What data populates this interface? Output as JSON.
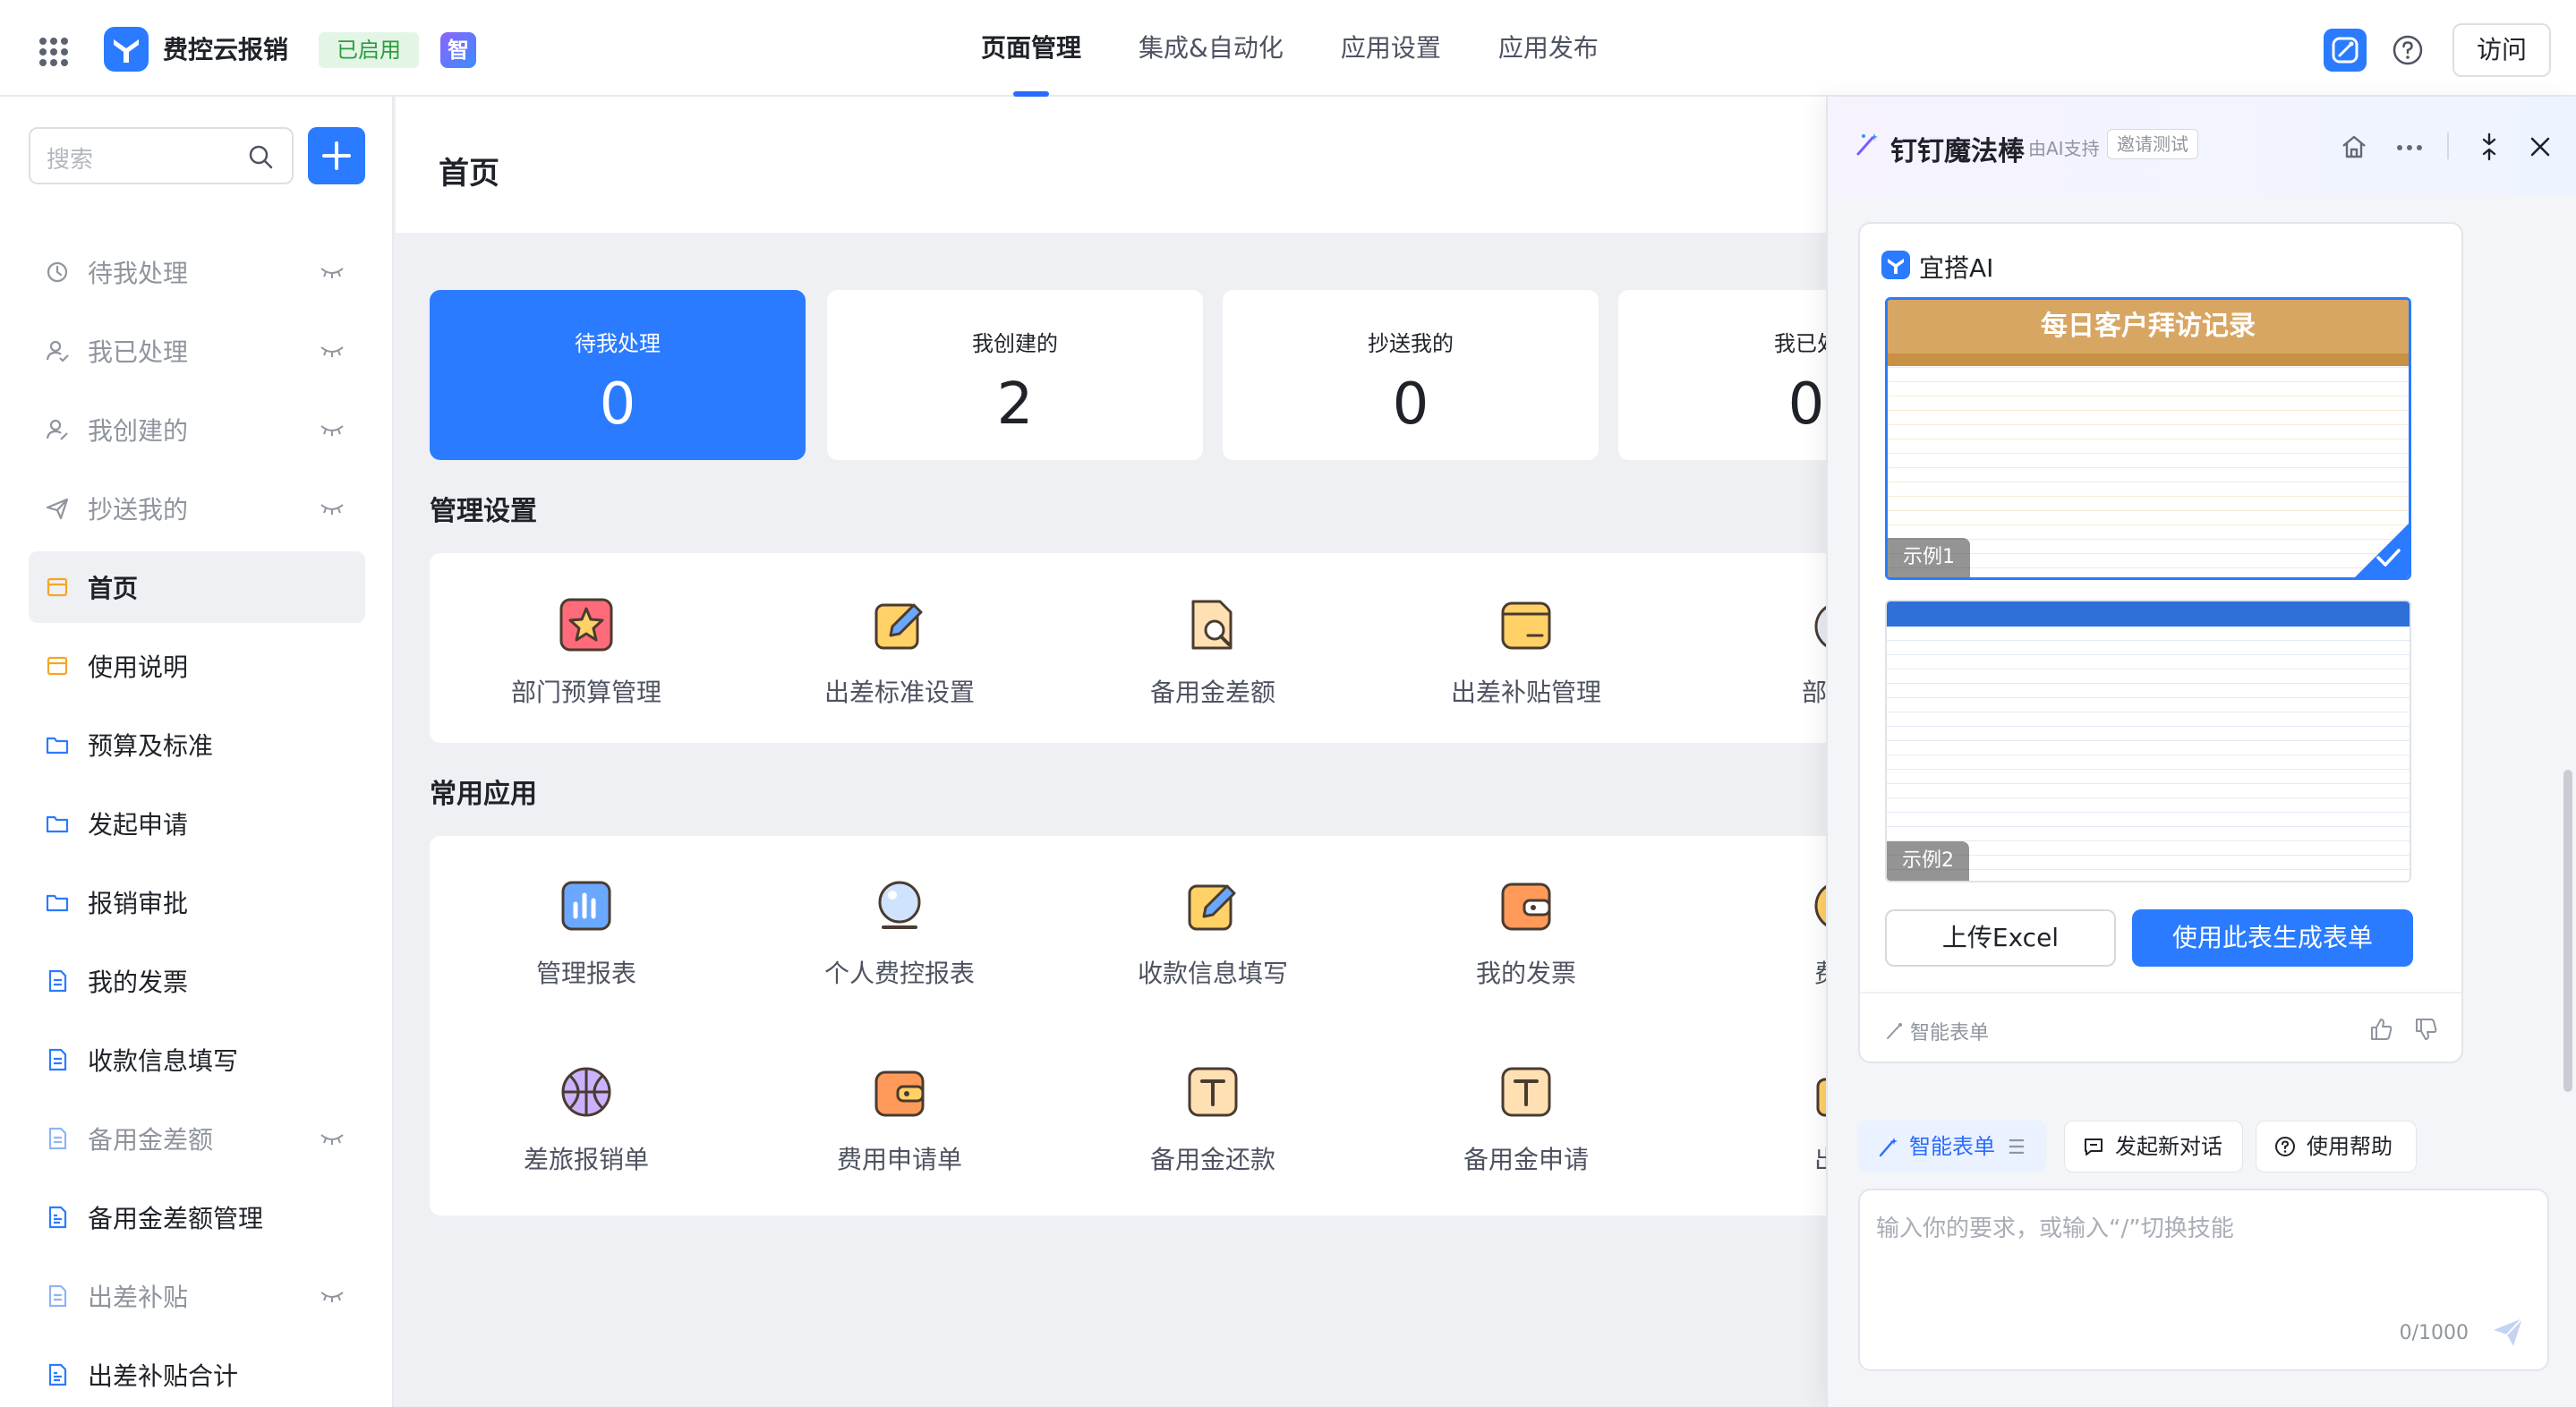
{
  "topbar": {
    "app_name": "费控云报销",
    "status": "已启用",
    "zhi": "智",
    "nav": [
      {
        "label": "页面管理",
        "active": true
      },
      {
        "label": "集成&自动化",
        "active": false
      },
      {
        "label": "应用设置",
        "active": false
      },
      {
        "label": "应用发布",
        "active": false
      }
    ],
    "visit_label": "访问",
    "accent_color": "#2a7bff"
  },
  "sidebar": {
    "search_placeholder": "搜索",
    "items": [
      {
        "label": "待我处理",
        "icon": "clock-icon",
        "muted": true,
        "hidden_eye": true
      },
      {
        "label": "我已处理",
        "icon": "user-check-icon",
        "muted": true,
        "hidden_eye": true
      },
      {
        "label": "我创建的",
        "icon": "user-edit-icon",
        "muted": true,
        "hidden_eye": true
      },
      {
        "label": "抄送我的",
        "icon": "send-icon",
        "muted": true,
        "hidden_eye": true
      },
      {
        "label": "首页",
        "icon": "page-icon",
        "active": true
      },
      {
        "label": "使用说明",
        "icon": "page-icon"
      },
      {
        "label": "预算及标准",
        "icon": "folder-icon"
      },
      {
        "label": "发起申请",
        "icon": "folder-icon"
      },
      {
        "label": "报销审批",
        "icon": "folder-icon"
      },
      {
        "label": "我的发票",
        "icon": "form-icon"
      },
      {
        "label": "收款信息填写",
        "icon": "form-icon"
      },
      {
        "label": "备用金差额",
        "icon": "form-icon",
        "muted": true,
        "hidden_eye": true
      },
      {
        "label": "备用金差额管理",
        "icon": "report-icon"
      },
      {
        "label": "出差补贴",
        "icon": "form-icon",
        "muted": true,
        "hidden_eye": true
      },
      {
        "label": "出差补贴合计",
        "icon": "report-icon"
      }
    ]
  },
  "main": {
    "page_title": "首页",
    "stats": [
      {
        "label": "待我处理",
        "value": "0",
        "primary": true
      },
      {
        "label": "我创建的",
        "value": "2"
      },
      {
        "label": "抄送我的",
        "value": "0"
      },
      {
        "label": "我已处",
        "value": "0"
      }
    ],
    "mgmt_title": "管理设置",
    "mgmt_items": [
      {
        "label": "部门预算管理",
        "icon": "star-badge-icon"
      },
      {
        "label": "出差标准设置",
        "icon": "edit-note-icon"
      },
      {
        "label": "备用金差额",
        "icon": "doc-search-icon"
      },
      {
        "label": "出差补贴管理",
        "icon": "wallet-icon"
      },
      {
        "label": "部门预",
        "icon": "gauge-icon"
      }
    ],
    "apps_title": "常用应用",
    "apps_row1": [
      {
        "label": "管理报表",
        "icon": "bar-chart-icon"
      },
      {
        "label": "个人费控报表",
        "icon": "crystal-ball-icon"
      },
      {
        "label": "收款信息填写",
        "icon": "edit-note-icon"
      },
      {
        "label": "我的发票",
        "icon": "card-wallet-icon"
      },
      {
        "label": "费用",
        "icon": "coin-icon"
      }
    ],
    "apps_row2": [
      {
        "label": "差旅报销单",
        "icon": "basketball-icon"
      },
      {
        "label": "费用申请单",
        "icon": "purse-icon"
      },
      {
        "label": "备用金还款",
        "icon": "t-box-icon"
      },
      {
        "label": "备用金申请",
        "icon": "t-box-icon"
      },
      {
        "label": "出差",
        "icon": "bag-icon"
      }
    ]
  },
  "ai_panel": {
    "title": "钉钉魔法棒",
    "subtitle": "由AI支持",
    "invite": "邀请测试",
    "card_title": "宜搭AI",
    "example1_title": "每日客户拜访记录",
    "example1_label": "示例1",
    "example2_label": "示例2",
    "upload_label": "上传Excel",
    "generate_label": "使用此表生成表单",
    "card_footer": "智能表单",
    "chips": [
      {
        "label": "智能表单",
        "icon": "wand-icon"
      },
      {
        "label": "发起新对话",
        "icon": "chat-icon"
      },
      {
        "label": "使用帮助",
        "icon": "help-icon"
      }
    ],
    "chip_menu": "☰",
    "input_placeholder": "输入你的要求，或输入“/”切换技能",
    "counter": "0/1000"
  }
}
